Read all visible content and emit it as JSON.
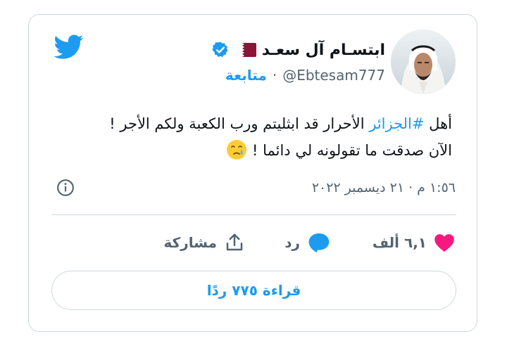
{
  "tweet": {
    "author": {
      "display_name": "ابتسـام آل سعـد",
      "handle": "@Ebtesam777",
      "follow_label": "متابعة"
    },
    "text_parts": {
      "prefix": "أهل ",
      "hashtag": "#الجزائر",
      "line1_rest": " الأحرار قد ابثليتم ورب الكعبة ولكم الأجر !",
      "line2": "الآن صدقت ما تقولونه لي دائما ! "
    },
    "timestamp": "١:٥٦ م · ٢١ ديسمبر ٢٠٢٢"
  },
  "actions": {
    "like_count": "٦,١ ألف",
    "reply_label": "رد",
    "share_label": "مشاركة"
  },
  "read_replies_label": "قراءة ٧٧٥ ردًا",
  "icons": {
    "logo": "twitter-bird-icon",
    "verified": "verified-badge-icon",
    "flag": "qatar-flag-icon",
    "emoji": "crying-face-emoji",
    "info": "info-icon",
    "like": "heart-icon",
    "reply": "speech-bubble-icon",
    "share": "share-upload-icon"
  },
  "colors": {
    "accent": "#1d9bf0",
    "like": "#f91880",
    "muted": "#536471",
    "border": "#cfd9de",
    "flag_maroon": "#8a1538"
  }
}
